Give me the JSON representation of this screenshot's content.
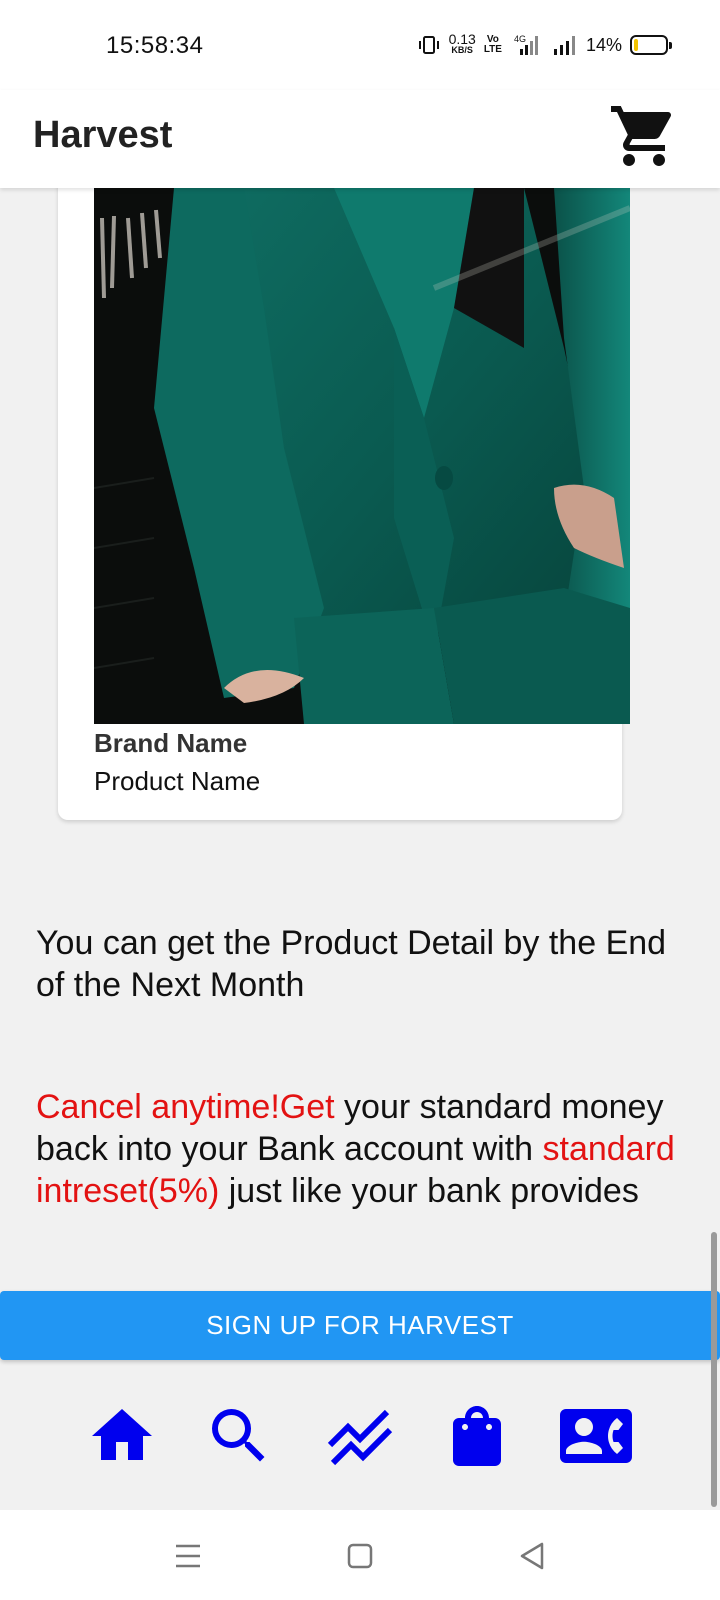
{
  "status_bar": {
    "time": "15:58:34",
    "net_speed_value": "0.13",
    "net_speed_unit": "KB/S",
    "volte_top": "Vo",
    "volte_bottom": "LTE",
    "network_type": "4G",
    "battery_percent": "14%",
    "battery_level": 0.14
  },
  "app_bar": {
    "title": "Harvest",
    "cart_icon": "shopping-cart-icon"
  },
  "product": {
    "brand": "Brand Name",
    "name": "Product Name"
  },
  "info": {
    "detail_text": "You can get the Product Detail by the End of the Next Month",
    "cancel_highlight": "Cancel anytime!Get",
    "cancel_text_1": " your standard money back into your Bank account with ",
    "interest_highlight": "standard intreset(5%)",
    "cancel_text_2": " just like your bank provides"
  },
  "signup_button": "SIGN UP FOR HARVEST",
  "bottom_nav": [
    {
      "icon": "home-icon"
    },
    {
      "icon": "search-icon"
    },
    {
      "icon": "trending-icon"
    },
    {
      "icon": "shopping-bag-icon"
    },
    {
      "icon": "contact-phone-icon"
    }
  ],
  "colors": {
    "accent": "#2196f3",
    "highlight_red": "#e31212",
    "nav_icon": "#0000ee"
  }
}
